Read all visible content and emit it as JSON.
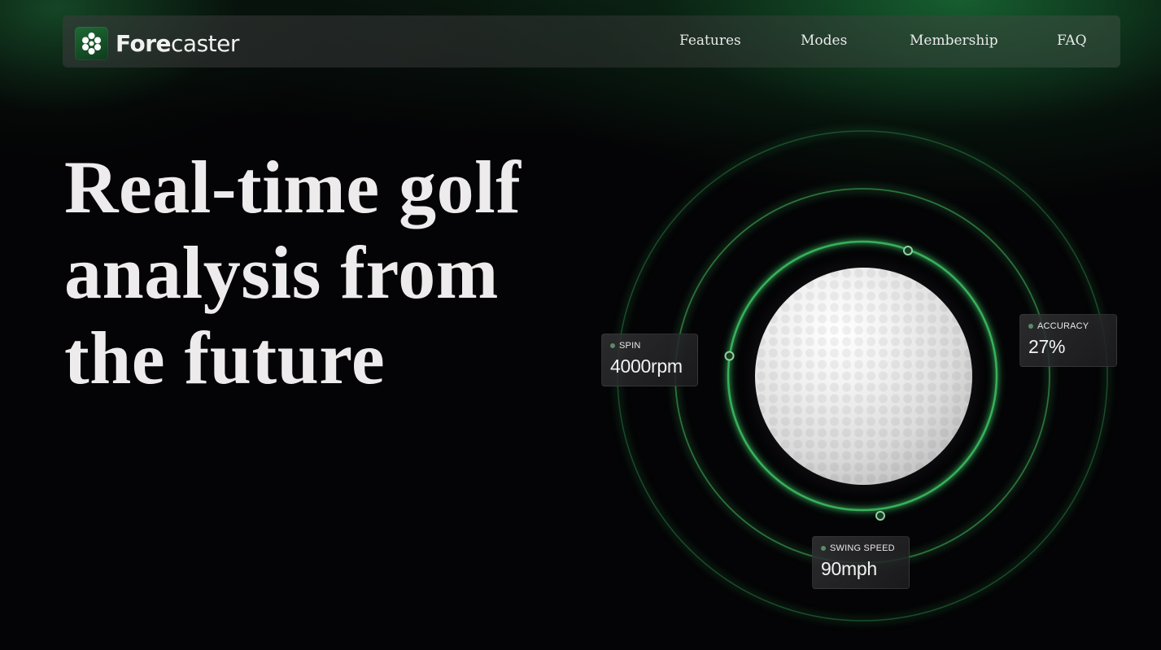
{
  "nav": {
    "logo_text_bold": "Fore",
    "logo_text_regular": "caster",
    "links": [
      "Features",
      "Modes",
      "Membership",
      "FAQ"
    ]
  },
  "hero": {
    "headline_lines": [
      "Real-time golf",
      "analysis from",
      "the future"
    ]
  },
  "stats": {
    "spin": {
      "label": "SPIN",
      "value": "4000rpm"
    },
    "accuracy": {
      "label": "ACCURACY",
      "value": "27%"
    },
    "swing_speed": {
      "label": "SWING SPEED",
      "value": "90mph"
    }
  },
  "colors": {
    "accent": "#2fa052",
    "background": "#040305",
    "text": "#eeebed"
  }
}
